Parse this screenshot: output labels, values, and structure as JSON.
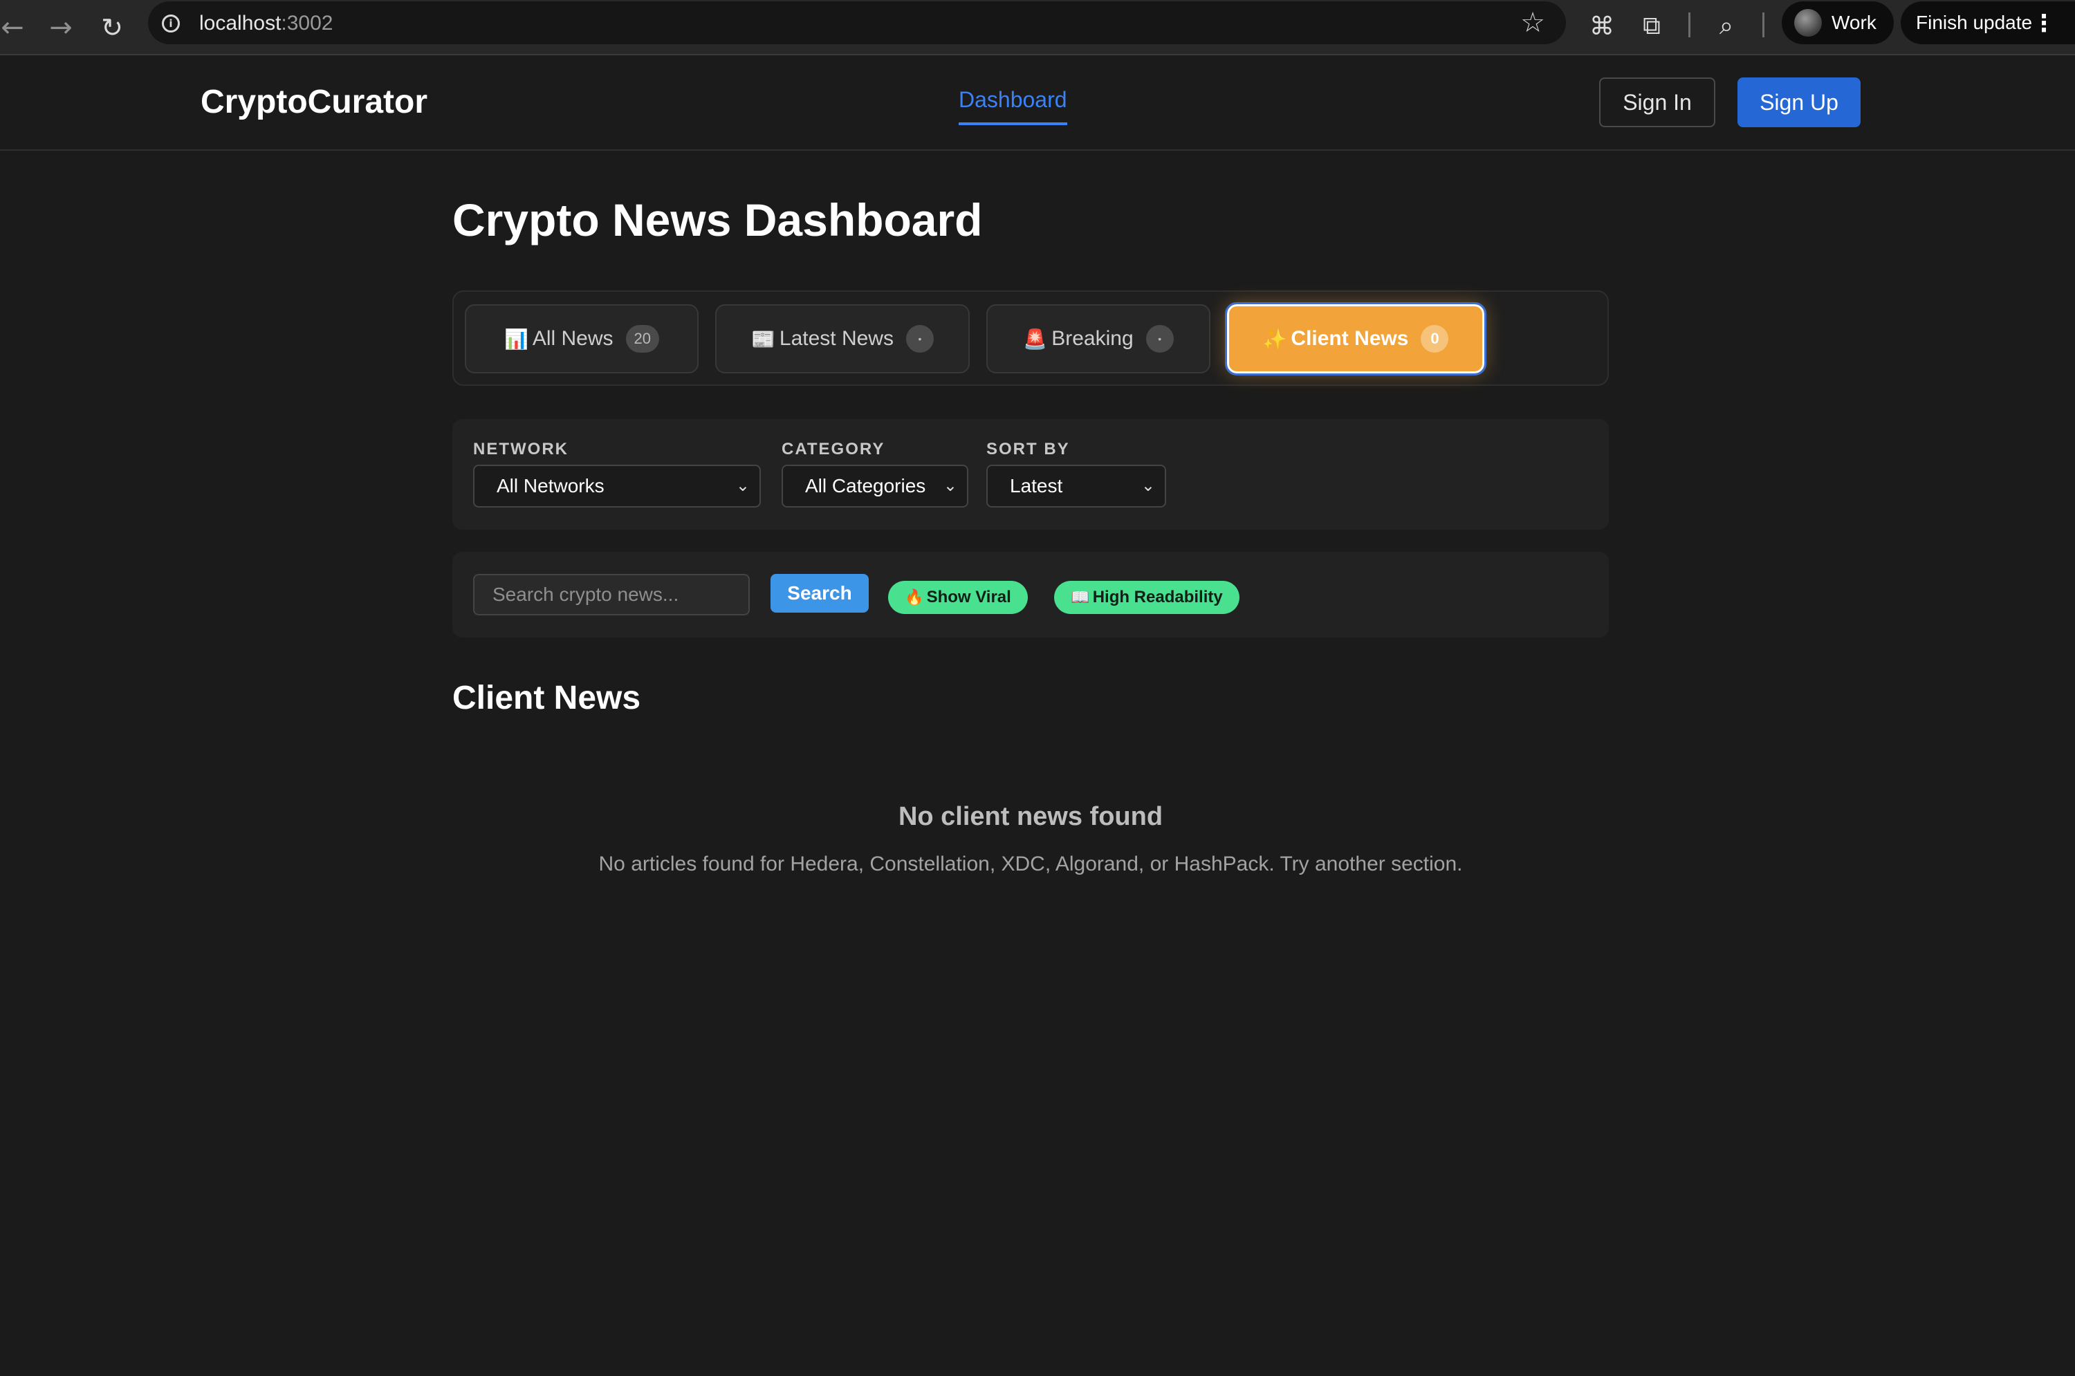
{
  "browser": {
    "url_host": "localhost",
    "url_port": ":3002",
    "profile_name": "Work",
    "update_label": "Finish update"
  },
  "header": {
    "brand": "CryptoCurator",
    "nav": [
      {
        "label": "Dashboard",
        "active": true
      }
    ],
    "sign_in": "Sign In",
    "sign_up": "Sign Up"
  },
  "page": {
    "title": "Crypto News Dashboard"
  },
  "tabs": [
    {
      "icon": "bar-chart-icon",
      "glyph": "📊",
      "label": "All News",
      "count": "20",
      "active": false
    },
    {
      "icon": "newspaper-icon",
      "glyph": "📰",
      "label": "Latest News",
      "count": "•",
      "active": false
    },
    {
      "icon": "siren-icon",
      "glyph": "🚨",
      "label": "Breaking",
      "count": "•",
      "active": false
    },
    {
      "icon": "sparkle-icon",
      "glyph": "✨",
      "label": "Client News",
      "count": "0",
      "active": true
    }
  ],
  "filters": {
    "network": {
      "label": "NETWORK",
      "value": "All Networks"
    },
    "category": {
      "label": "CATEGORY",
      "value": "All Categories"
    },
    "sort": {
      "label": "SORT BY",
      "value": "Latest"
    }
  },
  "search": {
    "placeholder": "Search crypto news...",
    "button": "Search",
    "chips": [
      {
        "icon": "fire-icon",
        "glyph": "🔥",
        "label": "Show Viral"
      },
      {
        "icon": "book-icon",
        "glyph": "📖",
        "label": "High Readability"
      }
    ]
  },
  "section": {
    "title": "Client News",
    "empty_title": "No client news found",
    "empty_desc": "No articles found for Hedera, Constellation, XDC, Algorand, or HashPack. Try another section."
  },
  "colors": {
    "accent_blue": "#3b82f6",
    "active_tab": "#f2a43a",
    "chip_green": "#49e08f",
    "search_button": "#3d95e8"
  }
}
